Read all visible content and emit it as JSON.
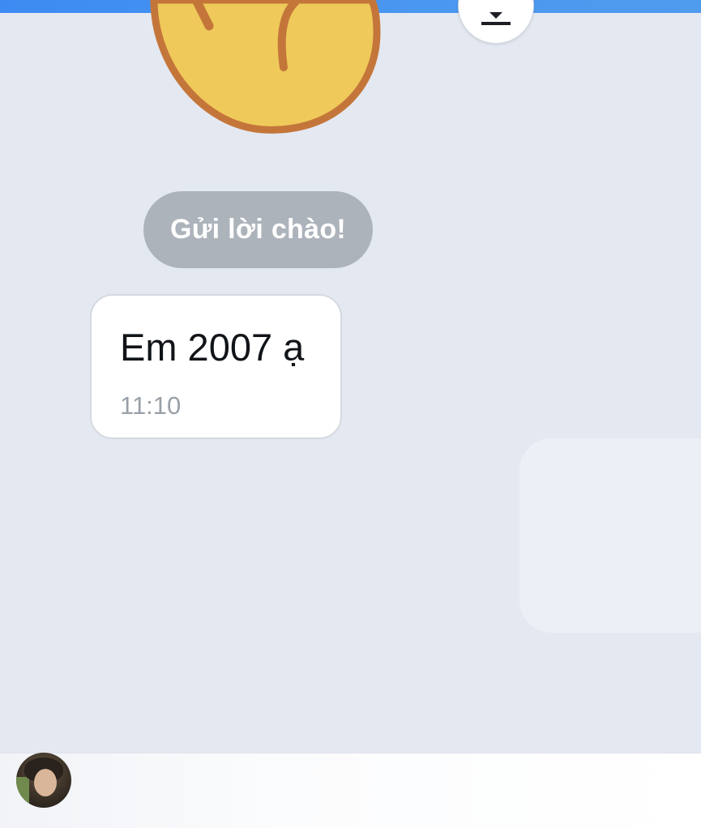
{
  "chat": {
    "greeting_label": "Gửi lời chào!",
    "messages": [
      {
        "text": "Em 2007 ạ",
        "time": "11:10"
      }
    ]
  },
  "icons": {
    "sticker": "smiley-sticker",
    "download": "download-icon"
  },
  "colors": {
    "background": "#e4e8f1",
    "top_bar": "#4a97f0",
    "greeting_pill": "#adb3bb",
    "bubble": "#ffffff"
  }
}
